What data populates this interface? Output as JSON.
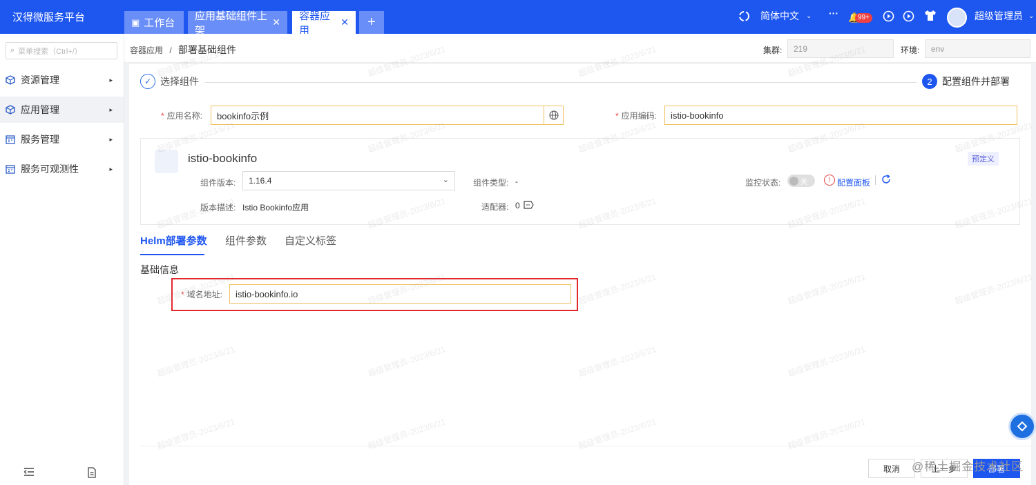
{
  "topbar": {
    "brand": "汉得微服务平台",
    "tabs": [
      {
        "label": "工作台",
        "closable": false
      },
      {
        "label": "应用基础组件上架",
        "closable": true
      },
      {
        "label": "容器应用",
        "closable": true
      }
    ],
    "add_tab": "+",
    "language": "简体中文",
    "more": "···",
    "notification_badge": "99+",
    "user_name": "超级管理员"
  },
  "sidebar": {
    "search_placeholder": "菜单搜索（Ctrl+/）",
    "items": [
      {
        "label": "资源管理"
      },
      {
        "label": "应用管理"
      },
      {
        "label": "服务管理"
      },
      {
        "label": "服务可观测性"
      }
    ]
  },
  "header": {
    "breadcrumb_parent": "容器应用",
    "breadcrumb_sep": "/",
    "breadcrumb_current": "部署基础组件",
    "cluster_label": "集群:",
    "cluster_value": "219",
    "env_label": "环境:",
    "env_value": "env"
  },
  "steps": {
    "step1_label": "选择组件",
    "step2_number": "2",
    "step2_label": "配置组件并部署"
  },
  "form": {
    "req": "*",
    "app_name_label": "应用名称:",
    "app_name_value": "bookinfo示例",
    "app_code_label": "应用编码:",
    "app_code_value": "istio-bookinfo"
  },
  "component_card": {
    "title": "istio-bookinfo",
    "tag": "预定义",
    "version_label": "组件版本:",
    "version_value": "1.16.4",
    "type_label": "组件类型:",
    "type_value": "-",
    "monitor_label": "监控状态:",
    "monitor_toggle": "关",
    "config_panel_link": "配置面板",
    "desc_label": "版本描述:",
    "desc_value": "Istio Bookinfo应用",
    "adapter_label": "适配器:",
    "adapter_value": "0"
  },
  "tabs": [
    "Helm部署参数",
    "组件参数",
    "自定义标签"
  ],
  "section": {
    "title": "基础信息",
    "domain_label": "域名地址:",
    "domain_value": "istio-bookinfo.io"
  },
  "footer": {
    "cancel": "取消",
    "prev": "上一步",
    "deploy": "部署",
    "watermark_text": "@稀土掘金技术社区"
  },
  "watermark": "超级管理员-2023/6/21",
  "colors": {
    "primary": "#1e56f0",
    "highlight_border": "#e0282d",
    "required": "#f04040"
  }
}
